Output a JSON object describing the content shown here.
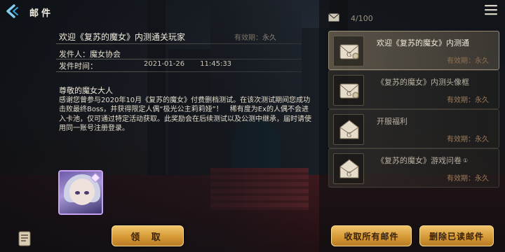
{
  "header": {
    "title": "邮件"
  },
  "mail_detail": {
    "title": "欢迎《复苏的魔女》内测通关玩家",
    "expiry_label": "有效期：",
    "expiry_value": "永久",
    "sender_label": "发件人：",
    "sender": "魔女协会",
    "time_label": "发件时间：",
    "date": "2021-01-26",
    "time": "11:45:33",
    "greeting": "尊敬的魔女大人",
    "body": "感谢您曾参与2020年10月《复苏的魔女》付费删档测试。在该次测试期间您成功击败最终Boss，并获得限定人偶“极光公主莉莉娅”！　稀有度为Ex的人偶不会进入卡池，仅可通过特定活动获取。此奖励会在后续测试以及公测中继承，届时请使用同一账号注册登录。",
    "claim_label": "领 取"
  },
  "mailbox": {
    "count": "4/100",
    "items": [
      {
        "title": "欢迎《复苏的魔女》内测通",
        "expiry": "有效期：永久",
        "selected": true
      },
      {
        "title": "《复苏的魔女》内测头像框",
        "expiry": "有效期：永久"
      },
      {
        "title": "开服福利",
        "expiry": "有效期：永久"
      },
      {
        "title": "《复苏的魔女》游戏问卷",
        "badge": "①",
        "expiry": "有效期：永久"
      }
    ],
    "claim_all_label": "收取所有邮件",
    "delete_read_label": "删除已读邮件"
  },
  "colors": {
    "accent_gold": "#d69a36",
    "reward_frame": "#c7a2f0"
  }
}
